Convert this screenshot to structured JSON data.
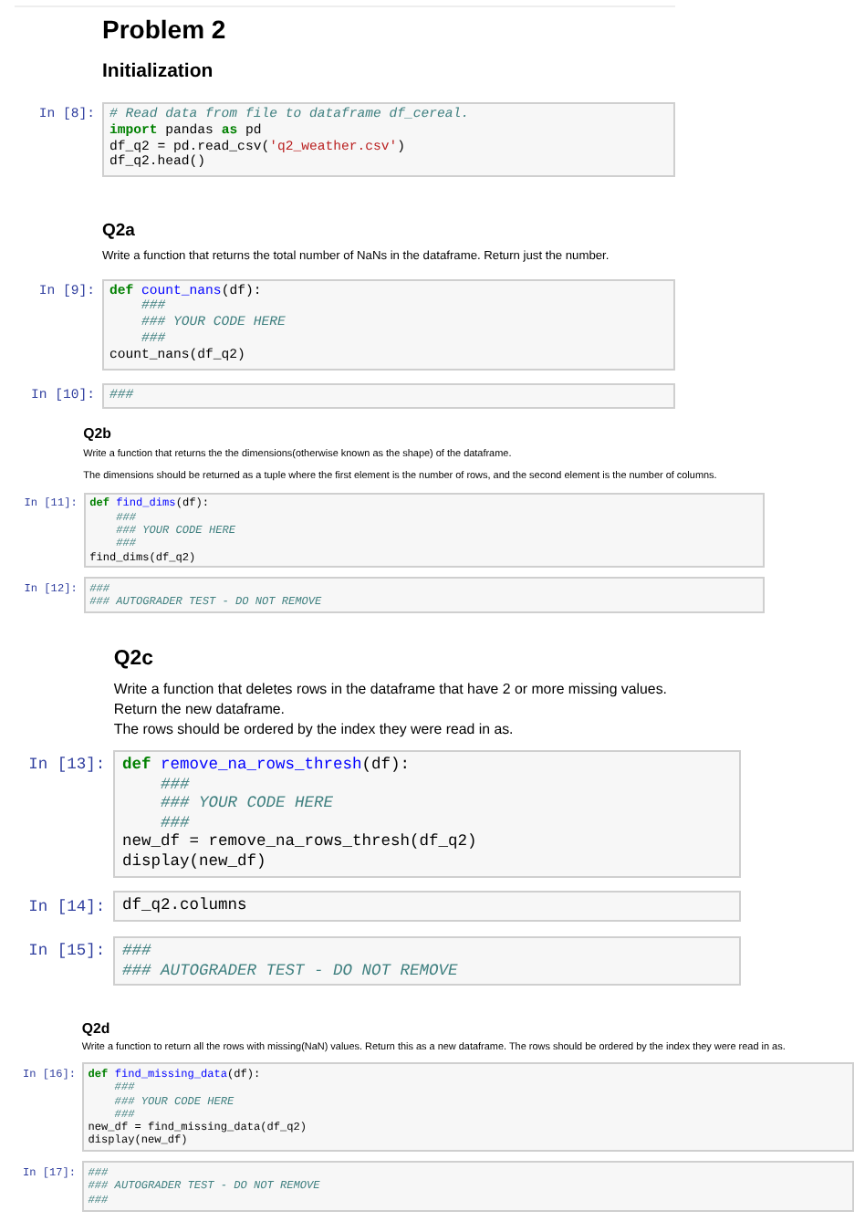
{
  "sections": [
    {
      "blocks": [
        {
          "kind": "title",
          "text": "Problem 2"
        },
        {
          "kind": "heading",
          "text": "Initialization"
        },
        {
          "kind": "code",
          "prompt": "In [8]:",
          "lines": [
            [
              {
                "kind": "comment",
                "text": "# Read data from file to dataframe df_cereal."
              }
            ],
            [
              {
                "kind": "kw",
                "text": "import"
              },
              {
                "kind": "plain",
                "text": " pandas "
              },
              {
                "kind": "kw",
                "text": "as"
              },
              {
                "kind": "plain",
                "text": " pd"
              }
            ],
            [
              {
                "kind": "plain",
                "text": "df_q2 = pd.read_csv("
              },
              {
                "kind": "str",
                "text": "'q2_weather.csv'"
              },
              {
                "kind": "plain",
                "text": ")"
              }
            ],
            [
              {
                "kind": "plain",
                "text": "df_q2.head()"
              }
            ]
          ]
        },
        {
          "kind": "subheading",
          "text": "Q2a"
        },
        {
          "kind": "para",
          "lines": [
            "Write a function that returns the total number of NaNs in the dataframe. Return just the number."
          ]
        },
        {
          "kind": "code",
          "prompt": "In [9]:",
          "lines": [
            [
              {
                "kind": "kw",
                "text": "def"
              },
              {
                "kind": "fn",
                "text": " count_nans"
              },
              {
                "kind": "plain",
                "text": "(df):"
              }
            ],
            [
              {
                "kind": "comment",
                "text": "    ###"
              }
            ],
            [
              {
                "kind": "comment",
                "text": "    ### YOUR CODE HERE"
              }
            ],
            [
              {
                "kind": "comment",
                "text": "    ###"
              }
            ],
            [
              {
                "kind": "plain",
                "text": "count_nans(df_q2)"
              }
            ]
          ]
        },
        {
          "kind": "code",
          "prompt": "In [10]:",
          "lines": [
            [
              {
                "kind": "comment",
                "text": "###"
              }
            ]
          ]
        }
      ]
    },
    {
      "blocks": [
        {
          "kind": "subheading",
          "text": "Q2b"
        },
        {
          "kind": "para",
          "lines": [
            "Write a function that returns the the dimensions(otherwise known as the shape) of the dataframe."
          ]
        },
        {
          "kind": "para",
          "lines": [
            "The dimensions should be returned as a tuple where the first element is the number of rows, and the second element is the number of columns."
          ]
        },
        {
          "kind": "code",
          "prompt": "In [11]:",
          "lines": [
            [
              {
                "kind": "kw",
                "text": "def"
              },
              {
                "kind": "fn",
                "text": " find_dims"
              },
              {
                "kind": "plain",
                "text": "(df):"
              }
            ],
            [
              {
                "kind": "comment",
                "text": "    ###"
              }
            ],
            [
              {
                "kind": "comment",
                "text": "    ### YOUR CODE HERE"
              }
            ],
            [
              {
                "kind": "comment",
                "text": "    ###"
              }
            ],
            [
              {
                "kind": "plain",
                "text": "find_dims(df_q2)"
              }
            ]
          ]
        },
        {
          "kind": "code",
          "prompt": "In [12]:",
          "lines": [
            [
              {
                "kind": "comment",
                "text": "###"
              }
            ],
            [
              {
                "kind": "comment",
                "text": "### AUTOGRADER TEST - DO NOT REMOVE"
              }
            ]
          ]
        }
      ]
    },
    {
      "blocks": [
        {
          "kind": "subheading",
          "text": "Q2c"
        },
        {
          "kind": "para",
          "lines": [
            "Write a function that deletes rows in the dataframe that have 2 or more missing values.",
            "Return the new dataframe.",
            "The rows should be ordered by the index they were read in as."
          ]
        },
        {
          "kind": "code",
          "prompt": "In [13]:",
          "lines": [
            [
              {
                "kind": "kw",
                "text": "def"
              },
              {
                "kind": "fn",
                "text": " remove_na_rows_thresh"
              },
              {
                "kind": "plain",
                "text": "(df):"
              }
            ],
            [
              {
                "kind": "comment",
                "text": "    ###"
              }
            ],
            [
              {
                "kind": "comment",
                "text": "    ### YOUR CODE HERE"
              }
            ],
            [
              {
                "kind": "comment",
                "text": "    ###"
              }
            ],
            [
              {
                "kind": "plain",
                "text": "new_df = remove_na_rows_thresh(df_q2)"
              }
            ],
            [
              {
                "kind": "plain",
                "text": "display(new_df)"
              }
            ]
          ]
        },
        {
          "kind": "code",
          "prompt": "In [14]:",
          "lines": [
            [
              {
                "kind": "plain",
                "text": "df_q2.columns"
              }
            ]
          ]
        },
        {
          "kind": "code",
          "prompt": "In [15]:",
          "lines": [
            [
              {
                "kind": "comment",
                "text": "###"
              }
            ],
            [
              {
                "kind": "comment",
                "text": "### AUTOGRADER TEST - DO NOT REMOVE"
              }
            ]
          ]
        }
      ]
    },
    {
      "blocks": [
        {
          "kind": "subheading",
          "text": "Q2d"
        },
        {
          "kind": "para",
          "lines": [
            "Write a function to return all the rows with missing(NaN) values. Return this as a new dataframe. The rows should be ordered by the index they were read in as."
          ]
        },
        {
          "kind": "code",
          "prompt": "In [16]:",
          "lines": [
            [
              {
                "kind": "kw",
                "text": "def"
              },
              {
                "kind": "fn",
                "text": " find_missing_data"
              },
              {
                "kind": "plain",
                "text": "(df):"
              }
            ],
            [
              {
                "kind": "comment",
                "text": "    ###"
              }
            ],
            [
              {
                "kind": "comment",
                "text": "    ### YOUR CODE HERE"
              }
            ],
            [
              {
                "kind": "comment",
                "text": "    ###"
              }
            ],
            [
              {
                "kind": "plain",
                "text": "new_df = find_missing_data(df_q2)"
              }
            ],
            [
              {
                "kind": "plain",
                "text": "display(new_df)"
              }
            ]
          ]
        },
        {
          "kind": "code",
          "prompt": "In [17]:",
          "lines": [
            [
              {
                "kind": "comment",
                "text": "###"
              }
            ],
            [
              {
                "kind": "comment",
                "text": "### AUTOGRADER TEST - DO NOT REMOVE"
              }
            ],
            [
              {
                "kind": "comment",
                "text": "###"
              }
            ]
          ]
        }
      ]
    }
  ]
}
